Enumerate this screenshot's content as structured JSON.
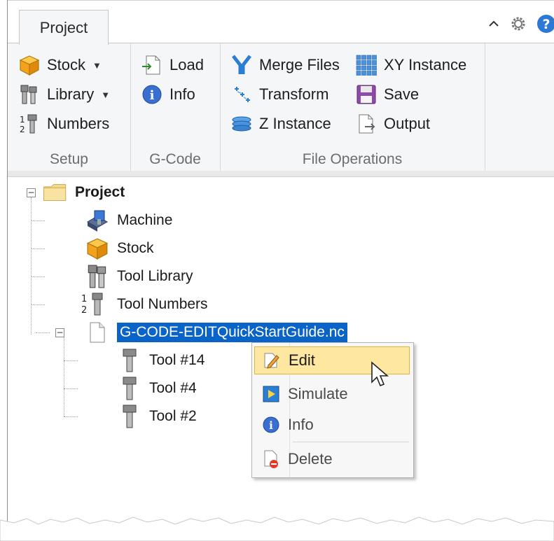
{
  "app": {
    "tab": "Project"
  },
  "ribbon": {
    "groups": {
      "setup": "Setup",
      "gcode": "G-Code",
      "file_operations": "File Operations"
    },
    "setup": {
      "stock": "Stock",
      "library": "Library",
      "numbers": "Numbers"
    },
    "gcode": {
      "load": "Load",
      "info": "Info"
    },
    "file_operations": {
      "merge_files": "Merge Files",
      "transform": "Transform",
      "z_instance": "Z Instance",
      "xy_instance": "XY Instance",
      "save": "Save",
      "output": "Output"
    }
  },
  "tree": {
    "root": "Project",
    "machine": "Machine",
    "stock": "Stock",
    "tool_library": "Tool Library",
    "tool_numbers": "Tool Numbers",
    "file": "G-CODE-EDITQuickStartGuide.nc",
    "tools": [
      "Tool #14",
      "Tool #4",
      "Tool #2"
    ]
  },
  "context_menu": {
    "edit": "Edit",
    "simulate": "Simulate",
    "info": "Info",
    "delete": "Delete"
  },
  "colors": {
    "selection": "#0a64c8",
    "menu_highlight": "#fde7a1",
    "ribbon_bg": "#f5f6f7"
  }
}
